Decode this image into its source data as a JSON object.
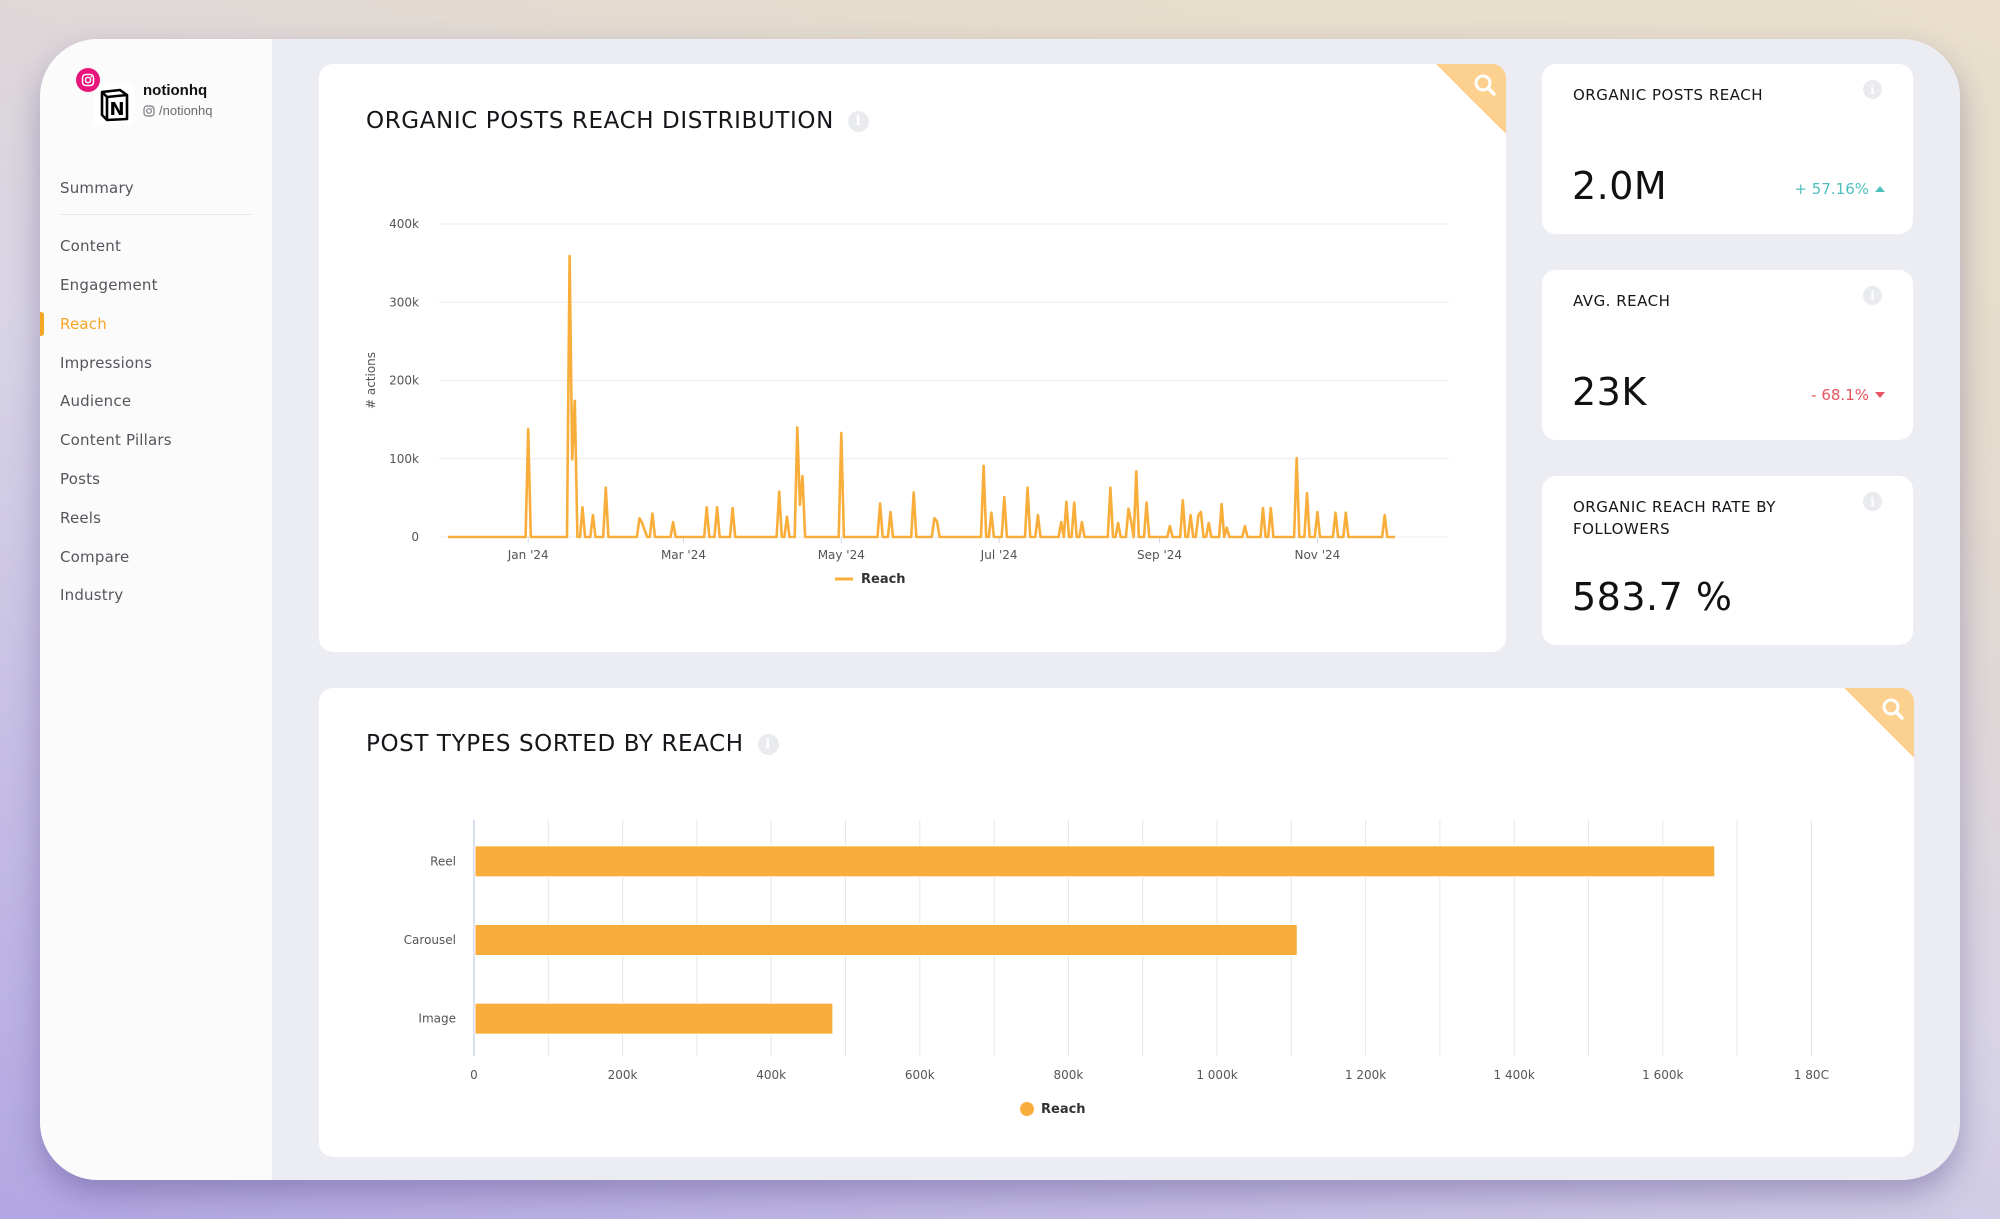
{
  "profile": {
    "name": "notionhq",
    "handle": "/notionhq",
    "platform": "instagram"
  },
  "sidebar": {
    "items": [
      {
        "label": "Summary",
        "active": false
      },
      {
        "label": "Content",
        "active": false
      },
      {
        "label": "Engagement",
        "active": false
      },
      {
        "label": "Reach",
        "active": true
      },
      {
        "label": "Impressions",
        "active": false
      },
      {
        "label": "Audience",
        "active": false
      },
      {
        "label": "Content Pillars",
        "active": false
      },
      {
        "label": "Posts",
        "active": false
      },
      {
        "label": "Reels",
        "active": false
      },
      {
        "label": "Compare",
        "active": false
      },
      {
        "label": "Industry",
        "active": false
      }
    ]
  },
  "colors": {
    "accent": "#f5a623",
    "bar": "#f9ae3b",
    "line": "#f9ae3b",
    "positive": "#4dbfbf",
    "negative": "#e8545f",
    "instagram": "#e8157d"
  },
  "kpis": [
    {
      "title": "ORGANIC POSTS REACH",
      "value": "2.0M",
      "delta": "+ 57.16%",
      "direction": "up"
    },
    {
      "title": "AVG. REACH",
      "value": "23K",
      "delta": "- 68.1%",
      "direction": "down"
    },
    {
      "title": "ORGANIC REACH RATE BY FOLLOWERS",
      "value": "583.7 %",
      "delta": null,
      "direction": null
    }
  ],
  "chart_data": [
    {
      "type": "line",
      "title": "ORGANIC POSTS REACH DISTRIBUTION",
      "xlabel": "",
      "ylabel": "# actions",
      "ylim": [
        0,
        400000
      ],
      "yticks": [
        0,
        100000,
        200000,
        300000,
        400000
      ],
      "ytick_labels": [
        "0",
        "100k",
        "200k",
        "300k",
        "400k"
      ],
      "xrange": [
        "2023-12-01",
        "2024-12-01"
      ],
      "xticks": [
        "2024-01-01",
        "2024-03-01",
        "2024-05-01",
        "2024-07-01",
        "2024-09-01",
        "2024-11-01"
      ],
      "xtick_labels": [
        "Jan '24",
        "Mar '24",
        "May '24",
        "Jul '24",
        "Sep '24",
        "Nov '24"
      ],
      "grid": true,
      "legend": "bottom-center",
      "baseline_value": 0,
      "series": [
        {
          "name": "Reach",
          "points": [
            [
              "2024-01-01",
              138000
            ],
            [
              "2024-01-17",
              359000
            ],
            [
              "2024-01-18",
              99000
            ],
            [
              "2024-01-19",
              174000
            ],
            [
              "2024-01-22",
              38000
            ],
            [
              "2024-01-26",
              28000
            ],
            [
              "2024-01-31",
              63000
            ],
            [
              "2024-02-13",
              24000
            ],
            [
              "2024-02-14",
              18000
            ],
            [
              "2024-02-15",
              9000
            ],
            [
              "2024-02-18",
              30000
            ],
            [
              "2024-02-26",
              19000
            ],
            [
              "2024-03-10",
              38000
            ],
            [
              "2024-03-14",
              38000
            ],
            [
              "2024-03-20",
              37000
            ],
            [
              "2024-04-07",
              58000
            ],
            [
              "2024-04-10",
              26000
            ],
            [
              "2024-04-14",
              140000
            ],
            [
              "2024-04-15",
              41000
            ],
            [
              "2024-04-16",
              78000
            ],
            [
              "2024-05-01",
              133000
            ],
            [
              "2024-05-16",
              43000
            ],
            [
              "2024-05-20",
              32000
            ],
            [
              "2024-05-29",
              57000
            ],
            [
              "2024-06-06",
              24000
            ],
            [
              "2024-06-07",
              20000
            ],
            [
              "2024-06-25",
              91000
            ],
            [
              "2024-06-28",
              31000
            ],
            [
              "2024-07-03",
              51000
            ],
            [
              "2024-07-12",
              63000
            ],
            [
              "2024-07-16",
              28000
            ],
            [
              "2024-07-25",
              19000
            ],
            [
              "2024-07-27",
              45000
            ],
            [
              "2024-07-30",
              44000
            ],
            [
              "2024-08-02",
              19000
            ],
            [
              "2024-08-13",
              63000
            ],
            [
              "2024-08-16",
              18000
            ],
            [
              "2024-08-20",
              36000
            ],
            [
              "2024-08-21",
              20000
            ],
            [
              "2024-08-23",
              84000
            ],
            [
              "2024-08-27",
              44000
            ],
            [
              "2024-09-05",
              14000
            ],
            [
              "2024-09-10",
              47000
            ],
            [
              "2024-09-13",
              28000
            ],
            [
              "2024-09-16",
              28000
            ],
            [
              "2024-09-17",
              32000
            ],
            [
              "2024-09-20",
              18000
            ],
            [
              "2024-09-25",
              42000
            ],
            [
              "2024-09-27",
              12000
            ],
            [
              "2024-10-04",
              14000
            ],
            [
              "2024-10-11",
              37000
            ],
            [
              "2024-10-14",
              37000
            ],
            [
              "2024-10-24",
              101000
            ],
            [
              "2024-10-28",
              56000
            ],
            [
              "2024-11-01",
              32000
            ],
            [
              "2024-11-08",
              31000
            ],
            [
              "2024-11-12",
              31000
            ],
            [
              "2024-11-27",
              28000
            ]
          ]
        }
      ]
    },
    {
      "type": "bar",
      "orientation": "horizontal",
      "title": "POST TYPES SORTED BY REACH",
      "xlabel": "",
      "ylabel": "",
      "categories": [
        "Reel",
        "Carousel",
        "Image"
      ],
      "series": [
        {
          "name": "Reach",
          "values": [
            1670000,
            1108000,
            483000
          ]
        }
      ],
      "xlim": [
        0,
        1900000
      ],
      "xticks": [
        0,
        200000,
        400000,
        600000,
        800000,
        1000000,
        1200000,
        1400000,
        1600000,
        1800000
      ],
      "xtick_labels": [
        "0",
        "200k",
        "400k",
        "600k",
        "800k",
        "1 000k",
        "1 200k",
        "1 400k",
        "1 600k",
        "1 80C"
      ],
      "minor_grid_step": 100000,
      "grid": true,
      "legend": "bottom-center"
    }
  ]
}
